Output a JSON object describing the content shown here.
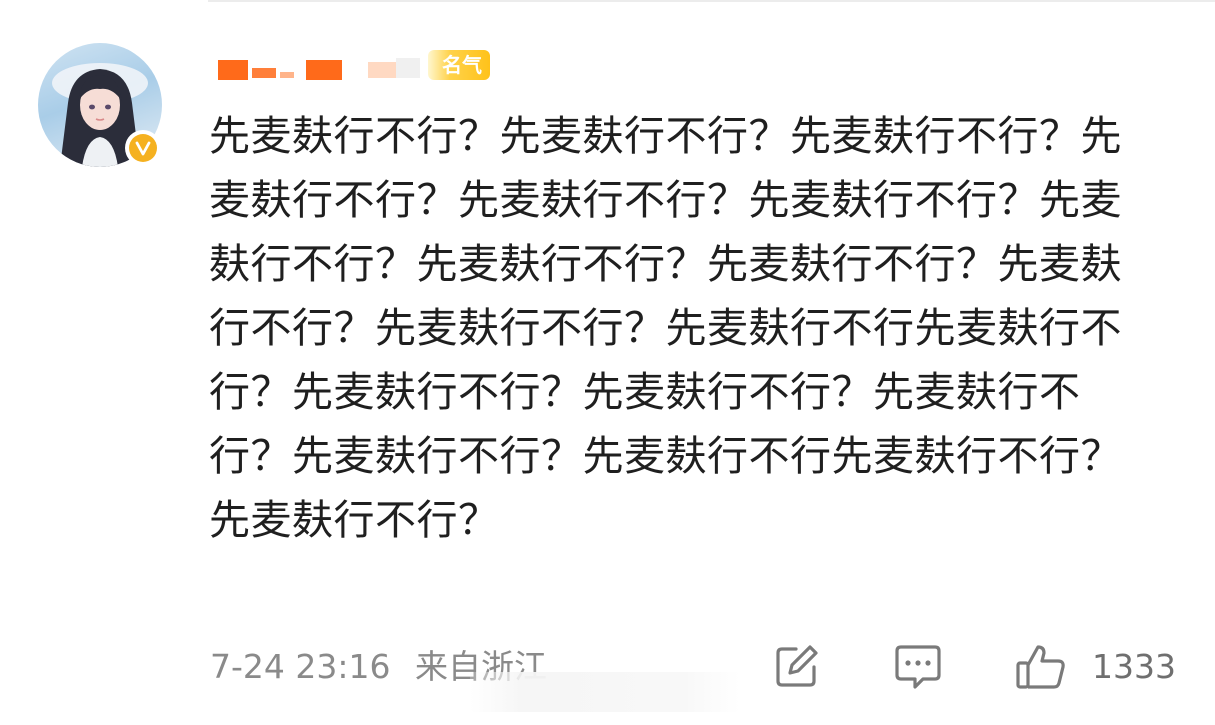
{
  "comment": {
    "fame_badge": "名气",
    "text": "先麦麸行不行？先麦麸行不行？先麦麸行不行？先麦麸行不行？先麦麸行不行？先麦麸行不行？先麦麸行不行？先麦麸行不行？先麦麸行不行？先麦麸行不行？先麦麸行不行？先麦麸行不行先麦麸行不行？先麦麸行不行？先麦麸行不行？先麦麸行不行？先麦麸行不行？先麦麸行不行先麦麸行不行？先麦麸行不行？",
    "timestamp": "7-24 23:16",
    "location": "来自浙江",
    "like_count": "1333"
  },
  "icons": {
    "edit": "edit-icon",
    "comment": "comment-icon",
    "like": "thumbs-up-icon",
    "verified": "verified-badge-icon"
  },
  "colors": {
    "verified": "#f5b120",
    "fame_badge": "#ffc21a",
    "meta_text": "#8a8a8a"
  }
}
